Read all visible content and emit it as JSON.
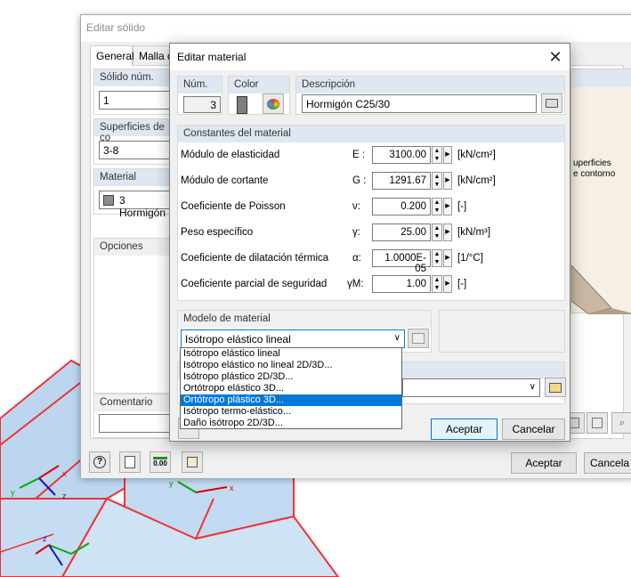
{
  "back_dialog": {
    "title": "Editar sólido",
    "tabs": [
      "General",
      "Malla de"
    ],
    "solid_num_label": "Sólido núm.",
    "solid_num_value": "1",
    "surfaces_label": "Superficies de co",
    "surfaces_value": "3-8",
    "material_label": "Material",
    "material_value": "3 Hormigón",
    "options_label": "Opciones",
    "comment_label": "Comentario",
    "preview_text1": "uperficies",
    "preview_text2": "e contorno",
    "ok_label": "Aceptar",
    "cancel_label": "Cancela"
  },
  "dialog": {
    "title": "Editar material",
    "num_label": "Núm.",
    "num_value": "3",
    "color_label": "Color",
    "color_swatch": "#7f7f7f",
    "description_label": "Descripción",
    "description_value": "Hormigón C25/30",
    "constants_header": "Constantes del material",
    "constants": [
      {
        "name": "Módulo de elasticidad",
        "symbol": "E :",
        "value": "3100.00",
        "unit": "[kN/cm²]"
      },
      {
        "name": "Módulo de cortante",
        "symbol": "G :",
        "value": "1291.67",
        "unit": "[kN/cm²]"
      },
      {
        "name": "Coeficiente de Poisson",
        "symbol": "ν:",
        "value": "0.200",
        "unit": "[-]"
      },
      {
        "name": "Peso específico",
        "symbol": "γ:",
        "value": "25.00",
        "unit": "[kN/m³]"
      },
      {
        "name": "Coeficiente de dilatación térmica",
        "symbol": "α:",
        "value": "1.0000E-05",
        "unit": "[1/°C]"
      },
      {
        "name": "Coeficiente parcial de seguridad",
        "symbol": "γM:",
        "value": "1.00",
        "unit": "[-]"
      }
    ],
    "model_header": "Modelo de material",
    "model_selected": "Isótropo elástico lineal",
    "model_options": [
      "Isótropo elástico lineal",
      "Isótropo elástico no lineal 2D/3D...",
      "Isótropo plástico 2D/3D...",
      "Ortótropo elástico 3D...",
      "Ortótropo plástico 3D...",
      "Isótropo termo-elástico...",
      "Daño isótropo 2D/3D..."
    ],
    "highlighted_index": 4,
    "ok_label": "Aceptar",
    "cancel_label": "Cancelar"
  },
  "footer_icons": [
    "help-icon",
    "edit-icon",
    "units-icon",
    "material-library-icon"
  ],
  "footer_units_text": "0.00"
}
